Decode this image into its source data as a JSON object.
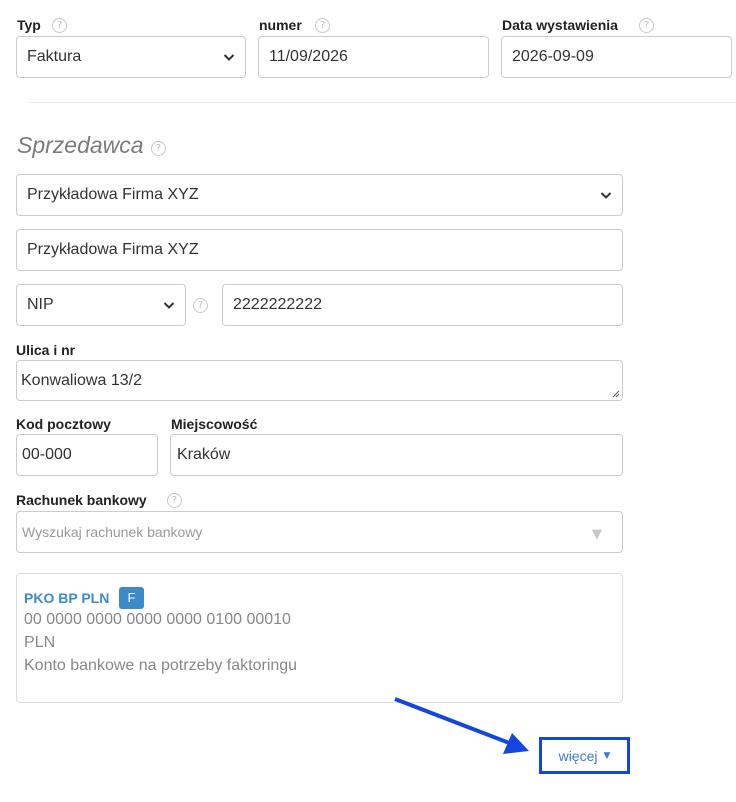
{
  "header": {
    "typ": {
      "label": "Typ",
      "value": "Faktura"
    },
    "numer": {
      "label": "numer",
      "value": "11/09/2026"
    },
    "data": {
      "label": "Data wystawienia",
      "value": "2026-09-09"
    }
  },
  "seller": {
    "title": "Sprzedawca",
    "company_select": "Przykładowa Firma XYZ",
    "company_name": "Przykładowa Firma XYZ",
    "tax_id_type": "NIP",
    "tax_id": "2222222222",
    "street_label": "Ulica i nr",
    "street": "Konwaliowa 13/2",
    "postal_label": "Kod pocztowy",
    "postal": "00-000",
    "city_label": "Miejscowość",
    "city": "Kraków",
    "bank_label": "Rachunek bankowy",
    "bank_placeholder": "Wyszukaj rachunek bankowy"
  },
  "bank_account": {
    "name": "PKO BP PLN",
    "badge": "F",
    "number": "00 0000 0000 0000 0000 0100 00010",
    "currency": "PLN",
    "description": "Konto bankowe na potrzeby faktoringu"
  },
  "more_button": {
    "label": "więcej"
  },
  "icons": {
    "help": "question-circle-icon",
    "dropdown": "chevron-down-icon",
    "caret": "caret-down-icon"
  },
  "colors": {
    "accent": "#3a8bc9",
    "highlight": "#1346e0"
  }
}
